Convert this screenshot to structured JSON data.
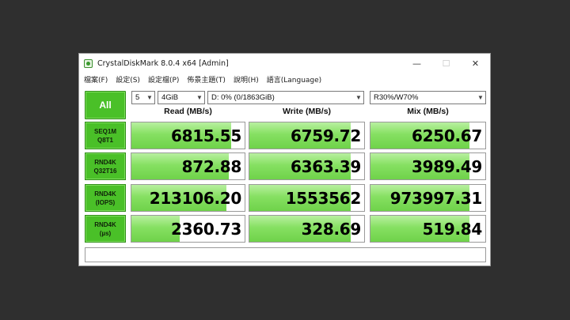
{
  "window": {
    "title": "CrystalDiskMark 8.0.4 x64 [Admin]",
    "minimize_glyph": "—",
    "maximize_glyph": "☐",
    "close_glyph": "✕"
  },
  "menu": [
    "檔案(F)",
    "設定(S)",
    "設定檔(P)",
    "佈景主題(T)",
    "說明(H)",
    "語言(Language)"
  ],
  "controls": {
    "all_label": "All",
    "count": "5",
    "size": "4GiB",
    "drive": "D: 0% (0/1863GiB)",
    "mix": "R30%/W70%"
  },
  "columns": [
    "Read (MB/s)",
    "Write (MB/s)",
    "Mix (MB/s)"
  ],
  "rows": [
    {
      "line1": "SEQ1M",
      "line2": "Q8T1",
      "read": "6815.55",
      "write": "6759.72",
      "mix": "6250.67"
    },
    {
      "line1": "RND4K",
      "line2": "Q32T16",
      "read": "872.88",
      "write": "6363.39",
      "mix": "3989.49"
    },
    {
      "line1": "RND4K",
      "line2": "(IOPS)",
      "read": "213106.20",
      "write": "1553562",
      "mix": "973997.31"
    },
    {
      "line1": "RND4K",
      "line2": "(µs)",
      "read": "2360.73",
      "write": "328.69",
      "mix": "519.84"
    }
  ],
  "bar_fill": [
    [
      0.88,
      0.88,
      0.86
    ],
    [
      0.86,
      0.88,
      0.86
    ],
    [
      0.84,
      0.88,
      0.86
    ],
    [
      0.43,
      0.88,
      0.86
    ]
  ],
  "comment": "",
  "colors": {
    "accent_green": "#4ac028",
    "bar_green": "#86e062",
    "background": "#2f2f2f"
  }
}
